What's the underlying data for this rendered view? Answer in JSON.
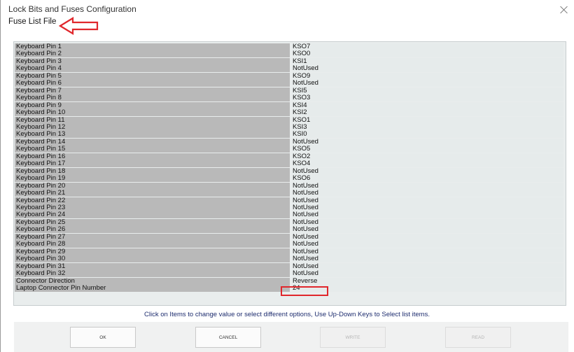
{
  "window": {
    "title": "Lock Bits and Fuses Configuration",
    "close_icon": "close-icon"
  },
  "menu": {
    "fuse_list_file": "Fuse List File"
  },
  "annotation": {
    "color": "#e0272c"
  },
  "grid": {
    "rows": [
      {
        "name": "Keyboard Pin 1",
        "value": "KSO7"
      },
      {
        "name": "Keyboard Pin 2",
        "value": "KSO0"
      },
      {
        "name": "Keyboard Pin 3",
        "value": "KSI1"
      },
      {
        "name": "Keyboard Pin 4",
        "value": "NotUsed"
      },
      {
        "name": "Keyboard Pin 5",
        "value": "KSO9"
      },
      {
        "name": "Keyboard Pin 6",
        "value": "NotUsed"
      },
      {
        "name": "Keyboard Pin 7",
        "value": "KSI5"
      },
      {
        "name": "Keyboard Pin 8",
        "value": "KSO3"
      },
      {
        "name": "Keyboard Pin 9",
        "value": "KSI4"
      },
      {
        "name": "Keyboard Pin 10",
        "value": "KSI2"
      },
      {
        "name": "Keyboard Pin 11",
        "value": "KSO1"
      },
      {
        "name": "Keyboard Pin 12",
        "value": "KSI3"
      },
      {
        "name": "Keyboard Pin 13",
        "value": "KSI0"
      },
      {
        "name": "Keyboard Pin 14",
        "value": "NotUsed"
      },
      {
        "name": "Keyboard Pin 15",
        "value": "KSO5"
      },
      {
        "name": "Keyboard Pin 16",
        "value": "KSO2"
      },
      {
        "name": "Keyboard Pin 17",
        "value": "KSO4"
      },
      {
        "name": "Keyboard Pin 18",
        "value": "NotUsed"
      },
      {
        "name": "Keyboard Pin 19",
        "value": "KSO6"
      },
      {
        "name": "Keyboard Pin 20",
        "value": "NotUsed"
      },
      {
        "name": "Keyboard Pin 21",
        "value": "NotUsed"
      },
      {
        "name": "Keyboard Pin 22",
        "value": "NotUsed"
      },
      {
        "name": "Keyboard Pin 23",
        "value": "NotUsed"
      },
      {
        "name": "Keyboard Pin 24",
        "value": "NotUsed"
      },
      {
        "name": "Keyboard Pin 25",
        "value": "NotUsed"
      },
      {
        "name": "Keyboard Pin 26",
        "value": "NotUsed"
      },
      {
        "name": "Keyboard Pin 27",
        "value": "NotUsed"
      },
      {
        "name": "Keyboard Pin 28",
        "value": "NotUsed"
      },
      {
        "name": "Keyboard Pin 29",
        "value": "NotUsed"
      },
      {
        "name": "Keyboard Pin 30",
        "value": "NotUsed"
      },
      {
        "name": "Keyboard Pin 31",
        "value": "NotUsed"
      },
      {
        "name": "Keyboard Pin 32",
        "value": "NotUsed"
      },
      {
        "name": "Connector Direction",
        "value": "Reverse"
      },
      {
        "name": "Laptop Connector Pin Number",
        "value": "24"
      }
    ]
  },
  "hint": "Click on Items to change value or select different options, Use Up-Down Keys to Select list items.",
  "buttons": {
    "ok": "OK",
    "cancel": "CANCEL",
    "write": "WRITE",
    "read": "READ"
  }
}
